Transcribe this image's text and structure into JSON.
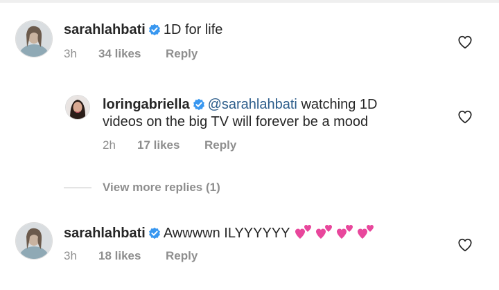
{
  "comments": [
    {
      "username": "sarahlahbati",
      "text": "1D for life",
      "time": "3h",
      "likes": "34 likes",
      "reply": "Reply"
    },
    {
      "username": "loringabriella",
      "mention": "@sarahlahbati",
      "text_line1": "watching 1D",
      "text_line2": "videos on the big TV will forever be a mood",
      "time": "2h",
      "likes": "17 likes",
      "reply": "Reply"
    },
    {
      "username": "sarahlahbati",
      "text": "Awwwwn ILYYYYYY",
      "emoji": "💕💕💕💕",
      "time": "3h",
      "likes": "18 likes",
      "reply": "Reply"
    }
  ],
  "view_more": "View more replies (1)",
  "colors": {
    "verified": "#3897f0",
    "secondary_text": "#8e8e8e",
    "mention": "#2b5c8a",
    "heart_outline": "#262626",
    "emoji_pink": "#e8479c"
  },
  "icons": [
    "verified-badge-icon",
    "heart-outline-icon",
    "two-hearts-emoji"
  ]
}
